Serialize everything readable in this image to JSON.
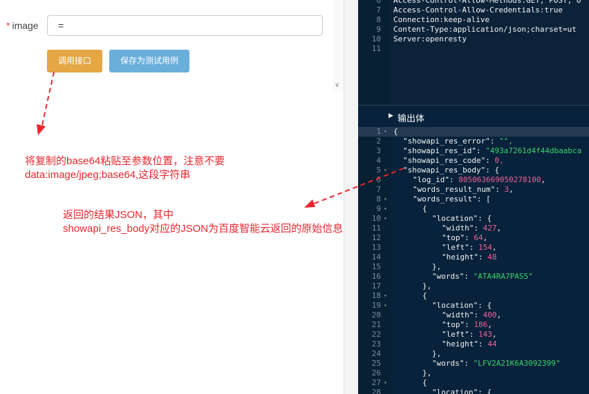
{
  "form": {
    "required_mark": "*",
    "label": "image",
    "value": "="
  },
  "buttons": {
    "call": "调用接口",
    "save": "保存为测试用例"
  },
  "notes": {
    "note1": "将复制的base64粘贴至参数位置，注意不要data:image/jpeg;base64,这段字符串",
    "note2_line1": "返回的结果JSON，其中",
    "note2_line2": "showapi_res_body对应的JSON为百度智能云返回的原始信息"
  },
  "colors": {
    "annotation": "#e8262d",
    "call_button": "#e4a744",
    "save_button": "#6aaedb",
    "editor_bg": "#07223a",
    "json_string": "#3fd36d",
    "json_number": "#f2609a"
  },
  "headers_panel": {
    "lines": [
      {
        "n": "6",
        "text": "Access-Control-Allow-Methods:GET, POST, O"
      },
      {
        "n": "7",
        "text": "Access-Control-Allow-Credentials:true"
      },
      {
        "n": "8",
        "text": "Connection:keep-alive"
      },
      {
        "n": "9",
        "text": "Content-Type:application/json;charset=ut"
      },
      {
        "n": "10",
        "text": "Server:openresty"
      },
      {
        "n": "11",
        "text": ""
      }
    ]
  },
  "body_panel": {
    "title": "输出体",
    "lines": [
      {
        "n": "1",
        "fold": true,
        "indent": 0,
        "key": "",
        "val": "{",
        "type": "p"
      },
      {
        "n": "2",
        "fold": false,
        "indent": 1,
        "key": "\"showapi_res_error\": ",
        "val": "\"\",",
        "type": "s"
      },
      {
        "n": "3",
        "fold": false,
        "indent": 1,
        "key": "\"showapi_res_id\": ",
        "val": "\"493a7261d4f44dbaabca",
        "type": "s"
      },
      {
        "n": "4",
        "fold": false,
        "indent": 1,
        "key": "\"showapi_res_code\": ",
        "val": "0,",
        "type": "n"
      },
      {
        "n": "5",
        "fold": true,
        "indent": 1,
        "key": "\"showapi_res_body\": ",
        "val": "{",
        "type": "p"
      },
      {
        "n": "6",
        "fold": false,
        "indent": 2,
        "key": "\"log_id\": ",
        "val": "805063669050278100",
        "type": "n",
        "tail": ","
      },
      {
        "n": "7",
        "fold": false,
        "indent": 2,
        "key": "\"words_result_num\": ",
        "val": "3",
        "type": "n",
        "tail": ","
      },
      {
        "n": "8",
        "fold": true,
        "indent": 2,
        "key": "\"words_result\": ",
        "val": "[",
        "type": "p"
      },
      {
        "n": "9",
        "fold": true,
        "indent": 3,
        "key": "",
        "val": "{",
        "type": "p"
      },
      {
        "n": "10",
        "fold": true,
        "indent": 4,
        "key": "\"location\": ",
        "val": "{",
        "type": "p"
      },
      {
        "n": "11",
        "fold": false,
        "indent": 5,
        "key": "\"width\": ",
        "val": "427",
        "type": "n",
        "tail": ","
      },
      {
        "n": "12",
        "fold": false,
        "indent": 5,
        "key": "\"top\": ",
        "val": "64",
        "type": "n",
        "tail": ","
      },
      {
        "n": "13",
        "fold": false,
        "indent": 5,
        "key": "\"left\": ",
        "val": "154",
        "type": "n",
        "tail": ","
      },
      {
        "n": "14",
        "fold": false,
        "indent": 5,
        "key": "\"height\": ",
        "val": "48",
        "type": "n"
      },
      {
        "n": "15",
        "fold": false,
        "indent": 4,
        "key": "",
        "val": "},",
        "type": "p"
      },
      {
        "n": "16",
        "fold": false,
        "indent": 4,
        "key": "\"words\": ",
        "val": "\"ATA4RA7PAS5\"",
        "type": "s"
      },
      {
        "n": "17",
        "fold": false,
        "indent": 3,
        "key": "",
        "val": "},",
        "type": "p"
      },
      {
        "n": "18",
        "fold": true,
        "indent": 3,
        "key": "",
        "val": "{",
        "type": "p"
      },
      {
        "n": "19",
        "fold": true,
        "indent": 4,
        "key": "\"location\": ",
        "val": "{",
        "type": "p"
      },
      {
        "n": "20",
        "fold": false,
        "indent": 5,
        "key": "\"width\": ",
        "val": "400",
        "type": "n",
        "tail": ","
      },
      {
        "n": "21",
        "fold": false,
        "indent": 5,
        "key": "\"top\": ",
        "val": "186",
        "type": "n",
        "tail": ","
      },
      {
        "n": "22",
        "fold": false,
        "indent": 5,
        "key": "\"left\": ",
        "val": "143",
        "type": "n",
        "tail": ","
      },
      {
        "n": "23",
        "fold": false,
        "indent": 5,
        "key": "\"height\": ",
        "val": "44",
        "type": "n"
      },
      {
        "n": "24",
        "fold": false,
        "indent": 4,
        "key": "",
        "val": "},",
        "type": "p"
      },
      {
        "n": "25",
        "fold": false,
        "indent": 4,
        "key": "\"words\": ",
        "val": "\"LFV2A21K6A3092399\"",
        "type": "s"
      },
      {
        "n": "26",
        "fold": false,
        "indent": 3,
        "key": "",
        "val": "},",
        "type": "p"
      },
      {
        "n": "27",
        "fold": true,
        "indent": 3,
        "key": "",
        "val": "{",
        "type": "p"
      },
      {
        "n": "28",
        "fold": false,
        "indent": 4,
        "key": "\"location\": ",
        "val": "{",
        "type": "p"
      }
    ]
  }
}
